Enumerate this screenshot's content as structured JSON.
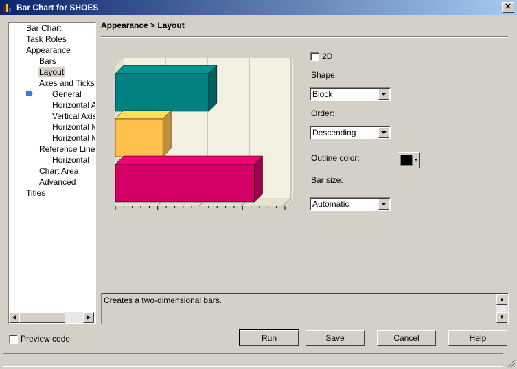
{
  "window": {
    "title": "Bar Chart for SHOES",
    "close_label": "✕"
  },
  "tree": {
    "items": [
      {
        "label": "Bar Chart"
      },
      {
        "label": "Task Roles"
      },
      {
        "label": "Appearance"
      },
      {
        "label": "Bars"
      },
      {
        "label": "Layout"
      },
      {
        "label": "Axes and Ticks"
      },
      {
        "label": "General"
      },
      {
        "label": "Horizontal Axis"
      },
      {
        "label": "Vertical Axis"
      },
      {
        "label": "Horizontal Major"
      },
      {
        "label": "Horizontal Minor"
      },
      {
        "label": "Reference Lines"
      },
      {
        "label": "Horizontal"
      },
      {
        "label": "Chart Area"
      },
      {
        "label": "Advanced"
      },
      {
        "label": "Titles"
      }
    ]
  },
  "panel": {
    "breadcrumb": "Appearance > Layout",
    "checkbox_2d": {
      "label": "2D",
      "checked": false
    },
    "shape": {
      "label": "Shape:",
      "value": "Block"
    },
    "order": {
      "label": "Order:",
      "value": "Descending"
    },
    "outline": {
      "label": "Outline color:",
      "color": "#000000"
    },
    "bar_size": {
      "label": "Bar size:",
      "value": "Automatic"
    }
  },
  "description": "Creates a two-dimensional bars.",
  "preview_code": {
    "label": "Preview code",
    "checked": false
  },
  "buttons": {
    "run": "Run",
    "save": "Save",
    "cancel": "Cancel",
    "help": "Help"
  },
  "chart_data": {
    "type": "bar",
    "orientation": "horizontal",
    "title": "",
    "xlabel": "",
    "ylabel": "",
    "categories": [
      "",
      "",
      ""
    ],
    "values": [
      0.55,
      0.28,
      0.82
    ],
    "colors": [
      "#008080",
      "#ffc04c",
      "#d40066"
    ],
    "grid": true,
    "style": "3D block preview"
  }
}
